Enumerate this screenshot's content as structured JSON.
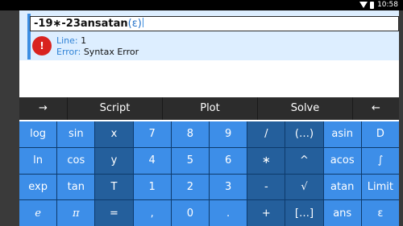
{
  "status": {
    "time": "10:58",
    "icons": [
      "wifi-icon",
      "battery-icon"
    ]
  },
  "entry": {
    "expression": "-19∗-23ansatan",
    "expression_suffix": "(ε)",
    "line_label": "Line:",
    "line_value": "1",
    "error_label": "Error:",
    "error_value": "Syntax Error",
    "error_icon": "!"
  },
  "toolbar": {
    "arrow_right": "→",
    "script": "Script",
    "plot": "Plot",
    "solve": "Solve",
    "arrow_left": "←"
  },
  "keypad": {
    "rows": [
      [
        "log",
        "sin",
        "x",
        "7",
        "8",
        "9",
        "/",
        "(…)",
        "asin",
        "D"
      ],
      [
        "ln",
        "cos",
        "y",
        "4",
        "5",
        "6",
        "∗",
        "^",
        "acos",
        "∫"
      ],
      [
        "exp",
        "tan",
        "T",
        "1",
        "2",
        "3",
        "-",
        "√",
        "atan",
        "Limit"
      ],
      [
        "e",
        "π",
        "=",
        ",",
        "0",
        ".",
        "+",
        "[…]",
        "ans",
        "ε"
      ]
    ]
  },
  "colors": {
    "key_light": "#3d8ee8",
    "key_dark": "#245f9c",
    "error_red": "#d9231f",
    "accent": "#3d8ee2"
  }
}
